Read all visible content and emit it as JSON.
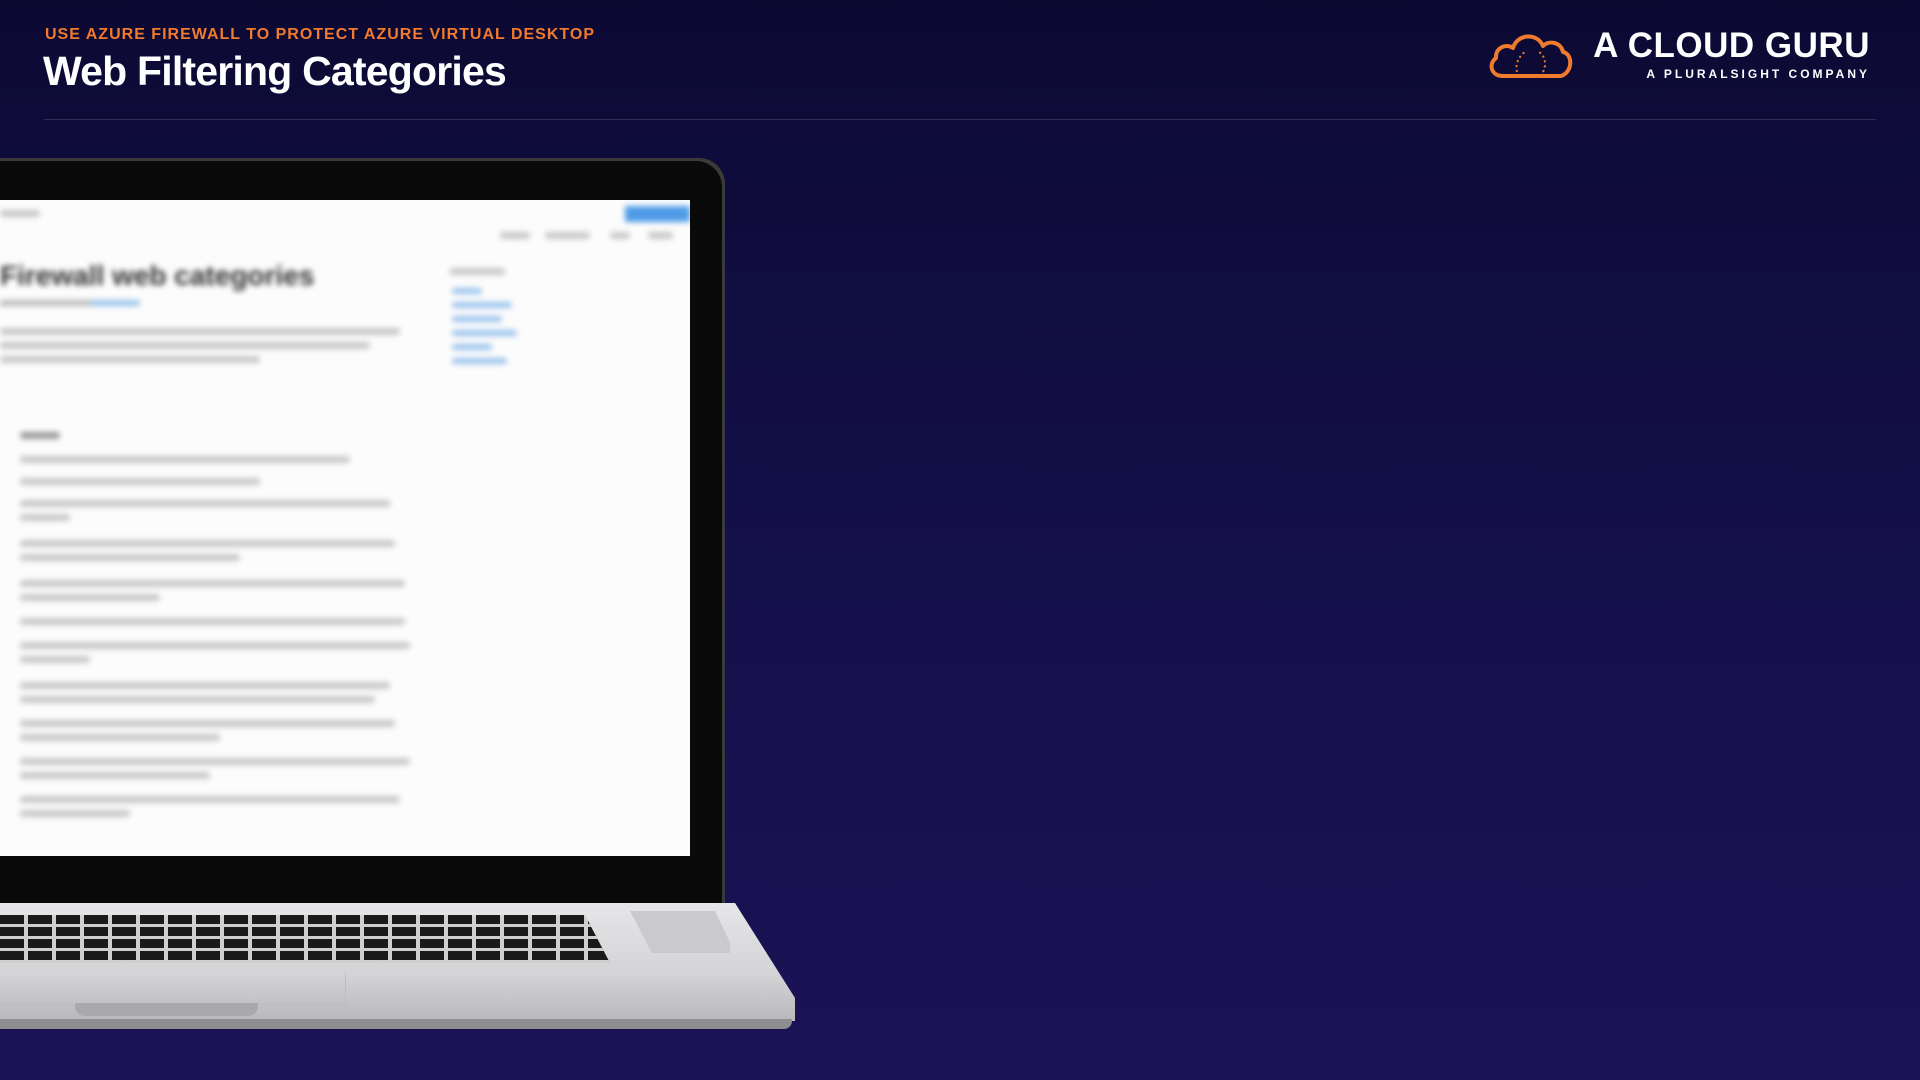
{
  "header": {
    "eyebrow": "USE AZURE FIREWALL TO PROTECT AZURE VIRTUAL DESKTOP",
    "title": "Web Filtering Categories"
  },
  "brand": {
    "name": "A CLOUD GURU",
    "tagline": "A PLURALSIGHT COMPANY",
    "logo_icon": "cloud-icon",
    "accent_color": "#f07a2e"
  },
  "laptop_screen": {
    "heading": "Firewall web categories"
  },
  "colors": {
    "background_top": "#0c0a33",
    "background_bottom": "#1b1356",
    "screen_link": "#4f9be8"
  }
}
